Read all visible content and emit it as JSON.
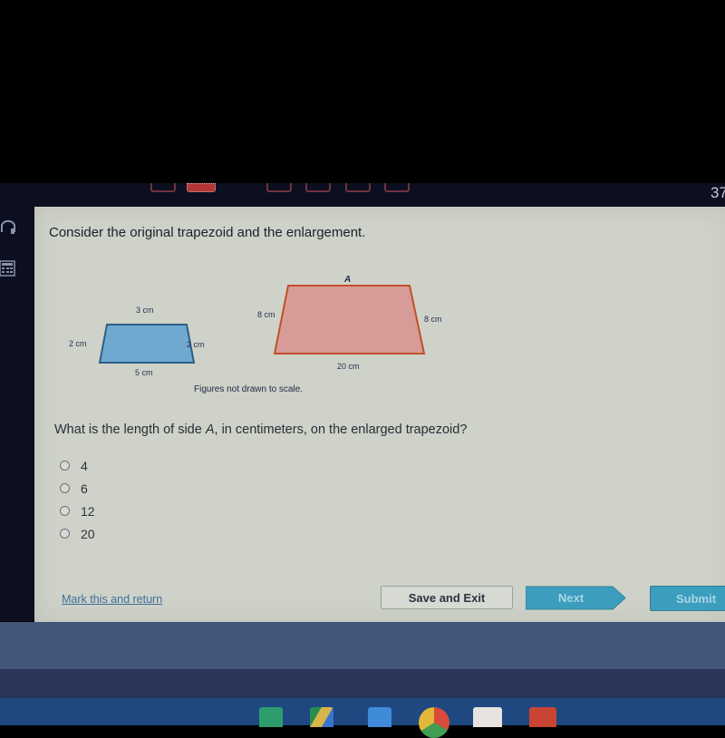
{
  "app_bar": {
    "question_counter": "37",
    "question_tabs": [
      {
        "state": "unanswered"
      },
      {
        "state": "current"
      },
      {
        "state": "unanswered"
      },
      {
        "state": "unanswered"
      },
      {
        "state": "unanswered"
      },
      {
        "state": "unanswered"
      }
    ]
  },
  "left_rail": {
    "icons": [
      "headphones-icon",
      "calculator-icon"
    ]
  },
  "prompt": "Consider the original trapezoid and the enlargement.",
  "figures": {
    "original": {
      "top": "3 cm",
      "left": "2 cm",
      "right": "2 cm",
      "bottom": "5 cm",
      "fill": "#6fa9cf",
      "stroke": "#2c5f86"
    },
    "enlarged": {
      "top": "A",
      "left": "8 cm",
      "right": "8 cm",
      "bottom": "20 cm",
      "fill": "#d79c97",
      "stroke": "#c0502c"
    },
    "note": "Figures not drawn to scale."
  },
  "question": {
    "before": "What is the length of side ",
    "variable": "A",
    "after": ", in centimeters, on the enlarged trapezoid?"
  },
  "choices": [
    "4",
    "6",
    "12",
    "20"
  ],
  "footer": {
    "mark_link": "Mark this and return",
    "save_exit": "Save and Exit",
    "next": "Next",
    "submit": "Submit"
  },
  "shelf": {
    "apps": [
      "sheets-icon",
      "drive-icon",
      "docs-icon",
      "chrome-icon",
      "gmail-icon",
      "youtube-icon"
    ]
  }
}
